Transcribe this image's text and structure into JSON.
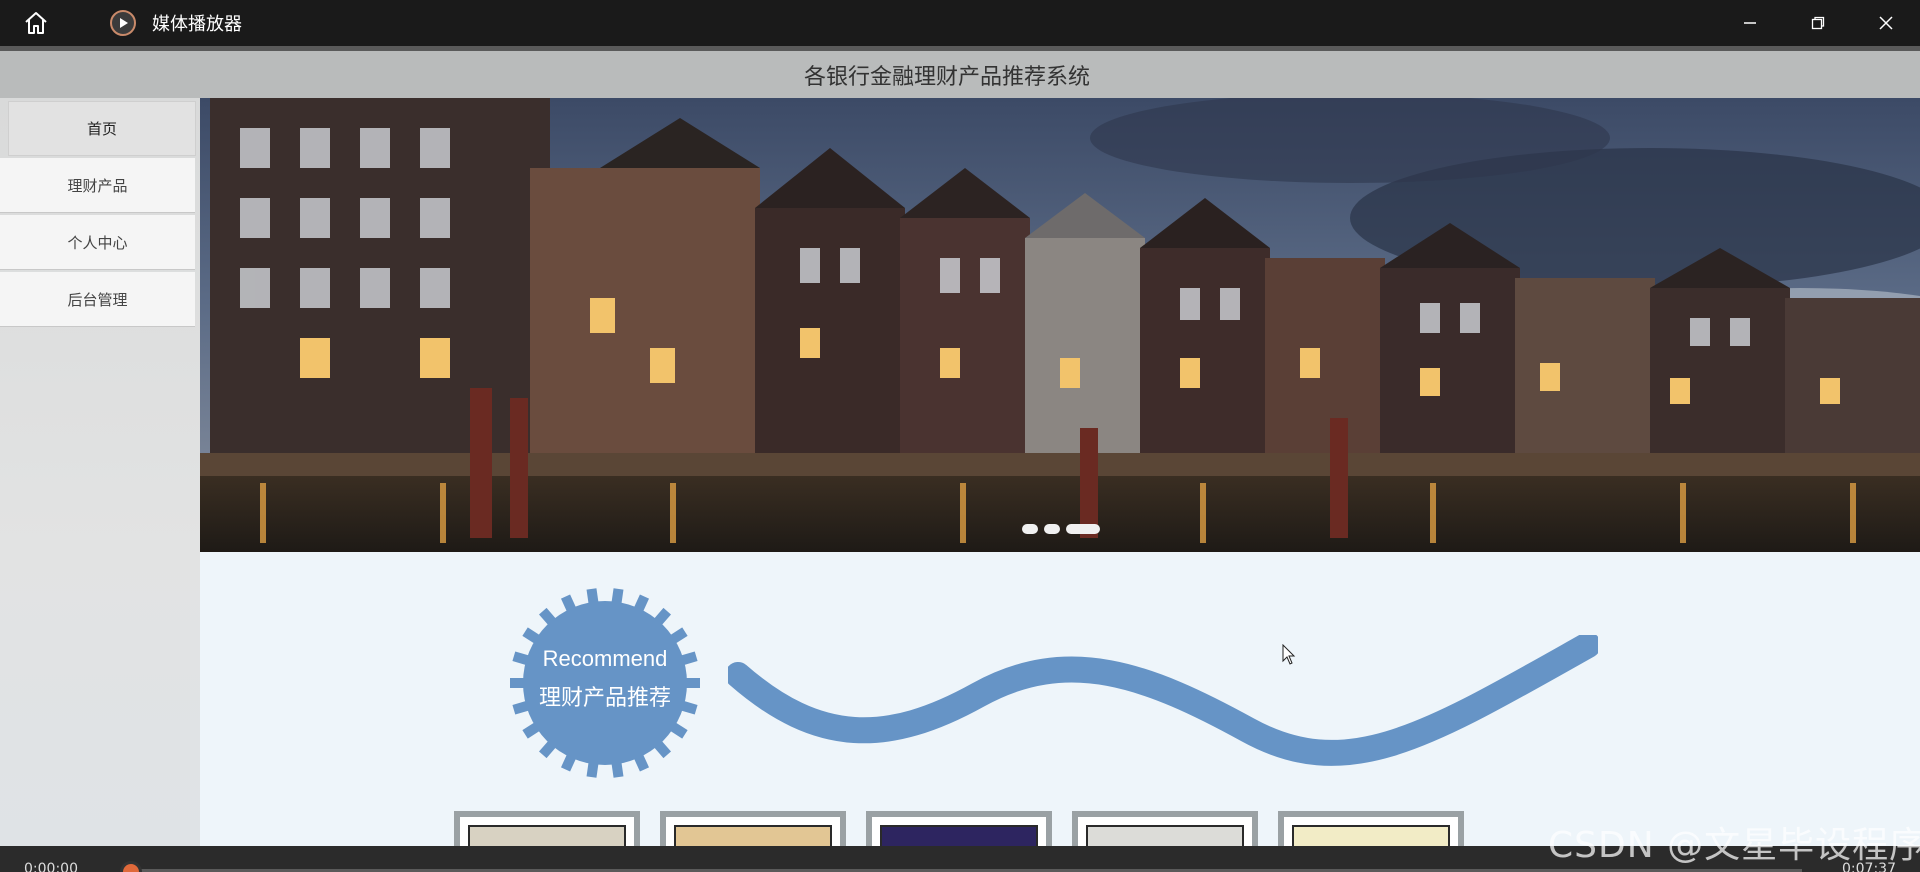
{
  "player": {
    "app_title": "媒体播放器",
    "time_current": "0:00:00",
    "time_total": "0:07:37",
    "progress": 0.0
  },
  "site": {
    "title": "各银行金融理财产品推荐系统"
  },
  "nav": {
    "items": [
      {
        "label": "首页",
        "active": true
      },
      {
        "label": "理财产品",
        "active": false
      },
      {
        "label": "个人中心",
        "active": false
      },
      {
        "label": "后台管理",
        "active": false
      }
    ]
  },
  "banner": {
    "slides": 3,
    "active_slide": 3
  },
  "recommend": {
    "line1": "Recommend",
    "line2": "理财产品推荐"
  },
  "watermark": "CSDN @文星毕设程序",
  "colors": {
    "accent_blue": "#6694c6",
    "player_dark": "#1a1a1a",
    "header_grey": "#b9bbbb",
    "seek_orange": "#e0693a"
  },
  "icons": [
    "home-icon",
    "play-icon",
    "minimize-icon",
    "restore-icon",
    "close-icon"
  ]
}
